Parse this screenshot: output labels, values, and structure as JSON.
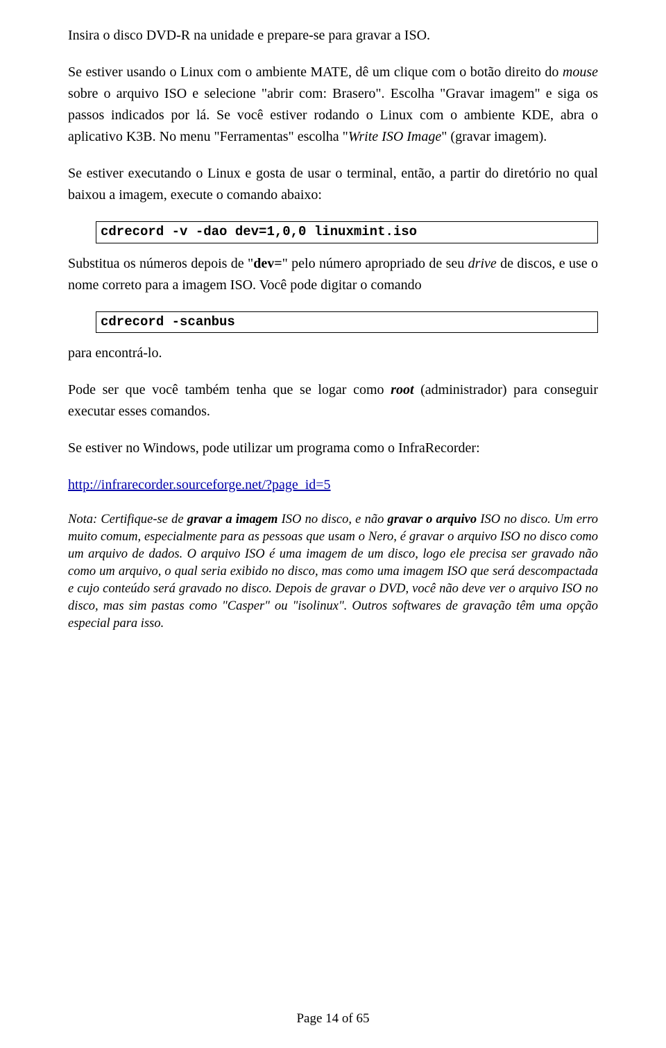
{
  "p1": "Insira o disco DVD-R na unidade e prepare-se para gravar a ISO.",
  "p2": {
    "t1": "Se estiver usando o Linux com o ambiente MATE, dê um clique com o botão direito do ",
    "i1": "mouse",
    "t2": " sobre o arquivo ISO e selecione \"abrir com: Brasero\". Escolha \"Gravar imagem\" e siga os passos indicados por lá. Se você estiver rodando o Linux com o ambiente KDE, abra o aplicativo K3B. No menu \"Ferramentas\" escolha \"",
    "i2": "Write ISO Image",
    "t3": "\" (gravar imagem)."
  },
  "p3": "Se  estiver executando o Linux e gosta de usar o terminal, então, a partir do diretório no qual baixou a imagem, execute o comando abaixo:",
  "cmd1": "cdrecord -v -dao dev=1,0,0 linuxmint.iso",
  "p4": {
    "t1": "Substitua os números depois de \"",
    "b1": "dev=",
    "t2": "\" pelo número apropriado de seu ",
    "i1": "drive",
    "t3": " de discos, e use o nome correto para a imagem ISO. Você pode digitar o comando"
  },
  "cmd2": "cdrecord -scanbus",
  "p5": "para encontrá-lo.",
  "p6": {
    "t1": "Pode ser que você também tenha que se logar como ",
    "b1": "root",
    "t2": " (administrador) para conseguir executar esses comandos."
  },
  "p7": "Se estiver no Windows, pode utilizar um programa como o InfraRecorder:",
  "link": "http://infrarecorder.sourceforge.net/?page_id=5",
  "note": {
    "t1": "Nota: Certifique-se de ",
    "b1": "gravar a imagem",
    "t2": " ISO no disco, e não ",
    "b2": "gravar o arquivo",
    "t3": " ISO no disco. Um erro muito comum, especialmente para as pessoas que usam o Nero, é gravar o arquivo ISO no disco como um arquivo de dados. O arquivo ISO é uma imagem de um disco, logo ele precisa ser gravado não como um arquivo, o qual seria exibido no disco, mas como uma imagem ISO que será descompactada e cujo conteúdo será gravado no disco. Depois de gravar o DVD, você não deve ver o arquivo ISO no disco, mas sim pastas como \"Casper\" ou \"isolinux\". Outros softwares de gravação têm uma opção especial para isso."
  },
  "footer": "Page 14 of 65"
}
